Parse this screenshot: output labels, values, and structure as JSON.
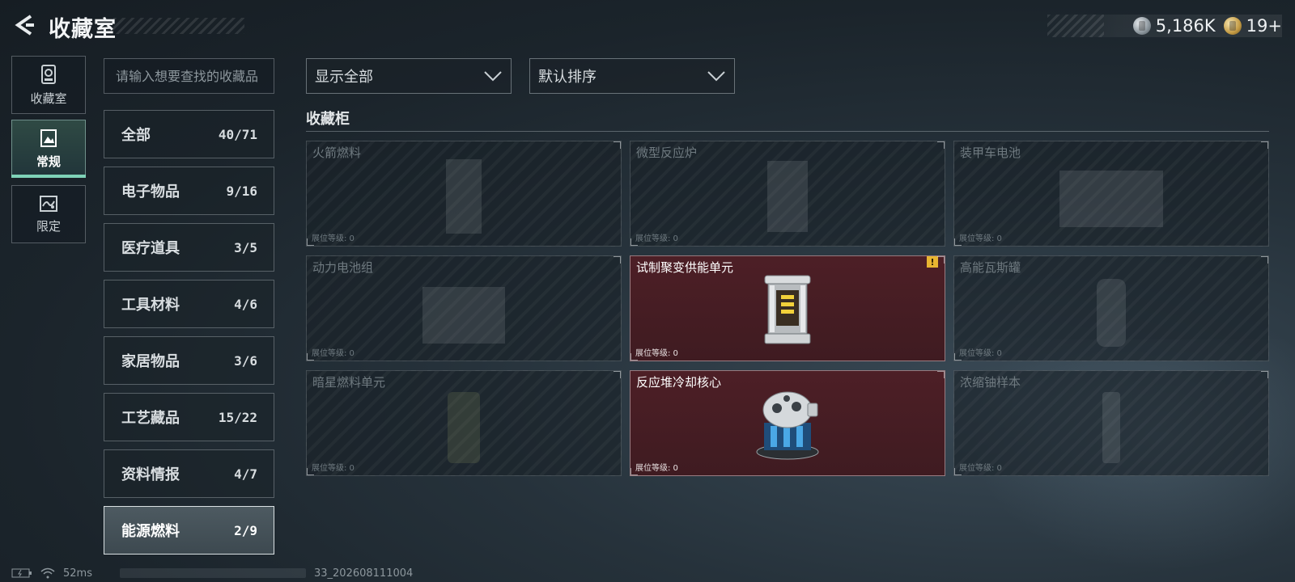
{
  "header": {
    "title": "收藏室",
    "currencies": [
      {
        "icon": "silver-coin-icon",
        "value": "5,186K"
      },
      {
        "icon": "gold-coin-icon",
        "value": "19+"
      }
    ]
  },
  "rail": [
    {
      "label": "收藏室",
      "icon": "collection-room-icon",
      "active": false
    },
    {
      "label": "常规",
      "icon": "regular-icon",
      "active": true
    },
    {
      "label": "限定",
      "icon": "limited-icon",
      "active": false
    }
  ],
  "search": {
    "placeholder": "请输入想要查找的收藏品"
  },
  "categories": [
    {
      "name": "全部",
      "count": "40/71"
    },
    {
      "name": "电子物品",
      "count": "9/16"
    },
    {
      "name": "医疗道具",
      "count": "3/5"
    },
    {
      "name": "工具材料",
      "count": "4/6"
    },
    {
      "name": "家居物品",
      "count": "3/6"
    },
    {
      "name": "工艺藏品",
      "count": "15/22"
    },
    {
      "name": "资料情报",
      "count": "4/7"
    },
    {
      "name": "能源燃料",
      "count": "2/9"
    }
  ],
  "filters": {
    "show": "显示全部",
    "sort": "默认排序"
  },
  "section_title": "收藏柜",
  "slots": [
    {
      "name": "火箭燃料",
      "level": "展位等级: 0",
      "owned": false,
      "icon": "rocket-fuel-icon"
    },
    {
      "name": "微型反应炉",
      "level": "展位等级: 0",
      "owned": false,
      "icon": "micro-reactor-icon"
    },
    {
      "name": "装甲车电池",
      "level": "展位等级: 0",
      "owned": false,
      "icon": "armored-battery-icon"
    },
    {
      "name": "动力电池组",
      "level": "展位等级: 0",
      "owned": false,
      "icon": "power-battery-pack-icon"
    },
    {
      "name": "试制聚变供能单元",
      "level": "展位等级: 0",
      "owned": true,
      "icon": "fusion-power-unit-icon",
      "badge": "!"
    },
    {
      "name": "高能瓦斯罐",
      "level": "展位等级: 0",
      "owned": false,
      "icon": "gas-canister-icon"
    },
    {
      "name": "暗星燃料单元",
      "level": "展位等级: 0",
      "owned": false,
      "icon": "darkstar-fuel-cell-icon"
    },
    {
      "name": "反应堆冷却核心",
      "level": "展位等级: 0",
      "owned": true,
      "icon": "reactor-cooling-core-icon"
    },
    {
      "name": "浓缩铀样本",
      "level": "展位等级: 0",
      "owned": false,
      "icon": "enriched-uranium-icon"
    }
  ],
  "footer": {
    "ping": "52ms",
    "build": "33_202608111004"
  }
}
